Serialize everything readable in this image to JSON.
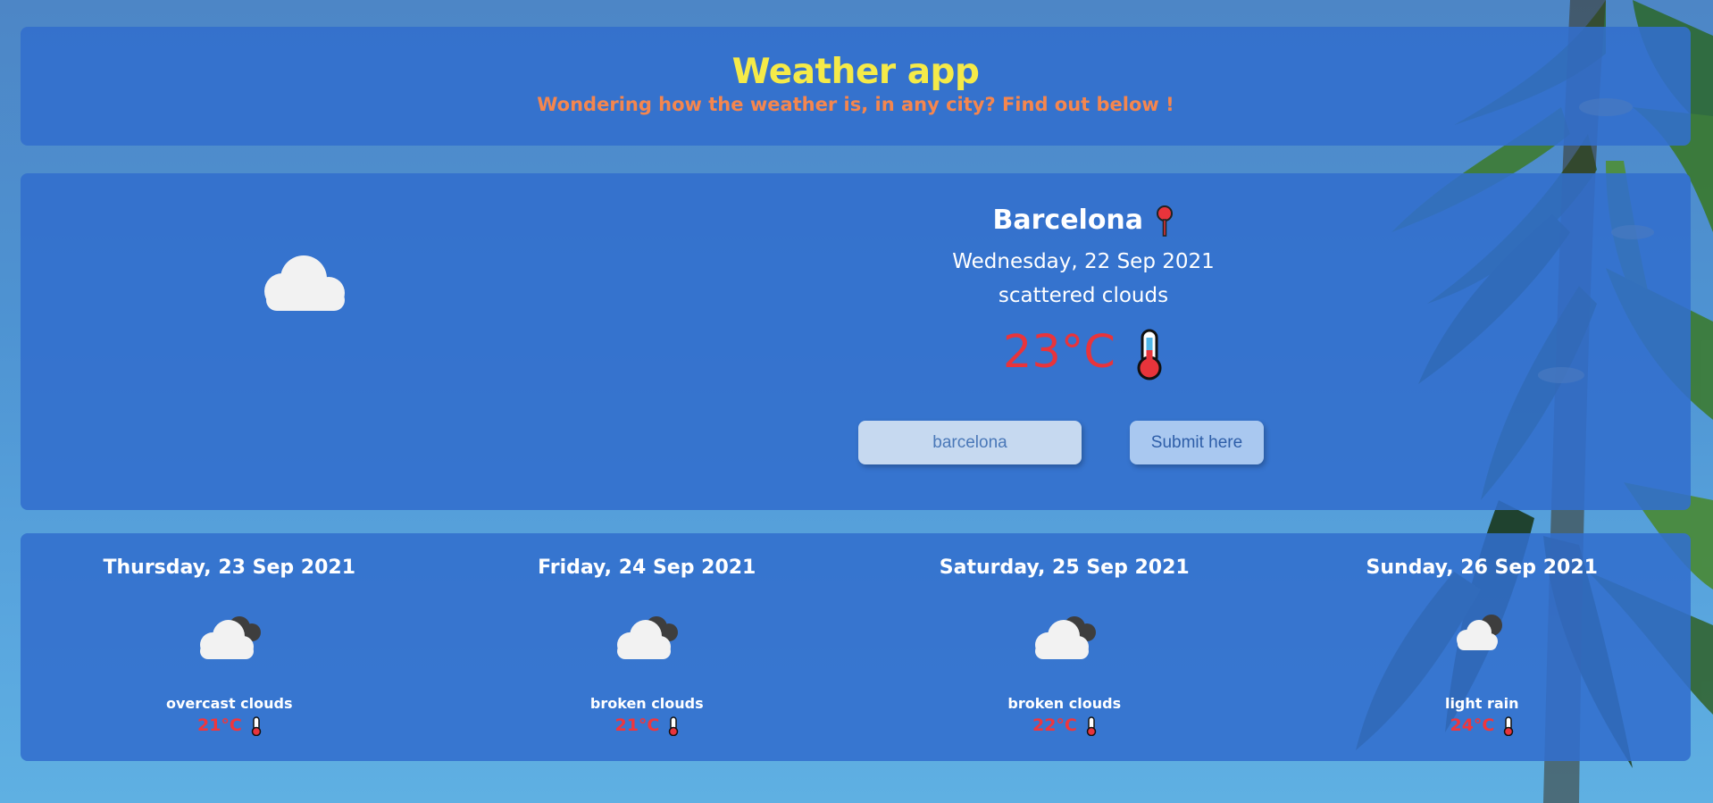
{
  "header": {
    "title": "Weather app",
    "subtitle": "Wondering how the weather is, in any city? Find out below !"
  },
  "current": {
    "city": "Barcelona",
    "date": "Wednesday, 22 Sep 2021",
    "description": "scattered clouds",
    "temperature": "23°C",
    "icon": "scattered-clouds-icon"
  },
  "search": {
    "value": "barcelona",
    "placeholder": "",
    "submit_label": "Submit here"
  },
  "forecast": [
    {
      "date": "Thursday, 23 Sep 2021",
      "description": "overcast clouds",
      "temperature": "21°C",
      "icon": "overcast-clouds-icon"
    },
    {
      "date": "Friday, 24 Sep 2021",
      "description": "broken clouds",
      "temperature": "21°C",
      "icon": "broken-clouds-icon"
    },
    {
      "date": "Saturday, 25 Sep 2021",
      "description": "broken clouds",
      "temperature": "22°C",
      "icon": "broken-clouds-icon"
    },
    {
      "date": "Sunday, 26 Sep 2021",
      "description": "light rain",
      "temperature": "24°C",
      "icon": "light-rain-icon"
    }
  ],
  "colors": {
    "title": "#f5ea48",
    "subtitle": "#f5864e",
    "temperature": "#e8343b",
    "panel": "#326ecd"
  }
}
